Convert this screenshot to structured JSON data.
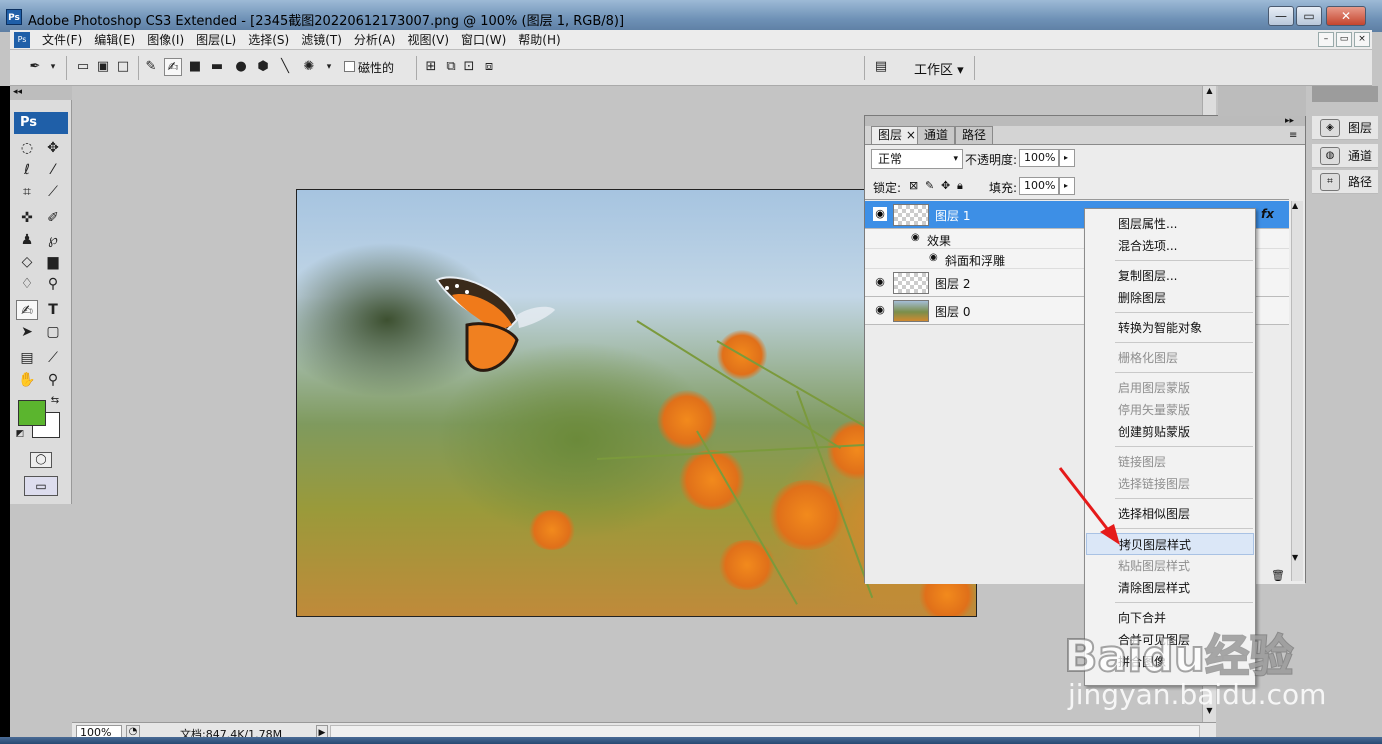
{
  "window": {
    "title": "Adobe Photoshop CS3 Extended - [2345截图20220612173007.png @ 100% (图层 1, RGB/8)]",
    "app_icon": "Ps",
    "controls": {
      "minimize": "—",
      "restore": "▭",
      "close": "✕"
    }
  },
  "menubar": {
    "icon": "Ps",
    "items": [
      "文件(F)",
      "编辑(E)",
      "图像(I)",
      "图层(L)",
      "选择(S)",
      "滤镜(T)",
      "分析(A)",
      "视图(V)",
      "窗口(W)",
      "帮助(H)"
    ],
    "doc_controls": {
      "minimize": "–",
      "restore": "▭",
      "close": "×"
    }
  },
  "options_bar": {
    "magnetic_label": "磁性的",
    "workspace_label": "工作区 ▾"
  },
  "toolbox": {
    "logo": "Ps",
    "foreground_color": "#5bb52e",
    "background_color": "#ffffff"
  },
  "status_bar": {
    "zoom": "100%",
    "doc_info": "文档:847.4K/1.78M"
  },
  "layers_panel": {
    "tabs": [
      {
        "label": "图层 ×",
        "active": true
      },
      {
        "label": "通道",
        "active": false
      },
      {
        "label": "路径",
        "active": false
      }
    ],
    "blend_mode": "正常",
    "opacity_label": "不透明度:",
    "opacity_value": "100%",
    "lock_label": "锁定:",
    "fill_label": "填充:",
    "fill_value": "100%",
    "layers": [
      {
        "name": "图层 1",
        "selected": true,
        "fx": "fx",
        "thumb": "transparent"
      },
      {
        "name": "图层 2",
        "selected": false,
        "thumb": "transparent"
      },
      {
        "name": "图层 0",
        "selected": false,
        "thumb": "image"
      }
    ],
    "effects_label": "效果",
    "bevel_label": "斜面和浮雕"
  },
  "context_menu": {
    "items": [
      {
        "label": "图层属性...",
        "enabled": true
      },
      {
        "label": "混合选项...",
        "enabled": true
      },
      {
        "sep": true
      },
      {
        "label": "复制图层...",
        "enabled": true
      },
      {
        "label": "删除图层",
        "enabled": true
      },
      {
        "sep": true
      },
      {
        "label": "转换为智能对象",
        "enabled": true
      },
      {
        "sep": true
      },
      {
        "label": "栅格化图层",
        "enabled": false
      },
      {
        "sep": true
      },
      {
        "label": "启用图层蒙版",
        "enabled": false
      },
      {
        "label": "停用矢量蒙版",
        "enabled": false
      },
      {
        "label": "创建剪贴蒙版",
        "enabled": true
      },
      {
        "sep": true
      },
      {
        "label": "链接图层",
        "enabled": false
      },
      {
        "label": "选择链接图层",
        "enabled": false
      },
      {
        "sep": true
      },
      {
        "label": "选择相似图层",
        "enabled": true
      },
      {
        "sep": true
      },
      {
        "label": "拷贝图层样式",
        "enabled": true,
        "highlighted": true
      },
      {
        "label": "粘贴图层样式",
        "enabled": false
      },
      {
        "label": "清除图层样式",
        "enabled": true
      },
      {
        "sep": true
      },
      {
        "label": "向下合并",
        "enabled": true
      },
      {
        "label": "合并可见图层",
        "enabled": true
      },
      {
        "label": "拼合图像",
        "enabled": true
      }
    ]
  },
  "dock": {
    "items": [
      {
        "label": "图层",
        "icon": "layers-icon"
      },
      {
        "label": "通道",
        "icon": "channels-icon"
      },
      {
        "label": "路径",
        "icon": "paths-icon"
      }
    ]
  },
  "watermark": {
    "brand": "Baidu经验",
    "url": "jingyan.baidu.com"
  },
  "annotation_color": "#e51a1a"
}
